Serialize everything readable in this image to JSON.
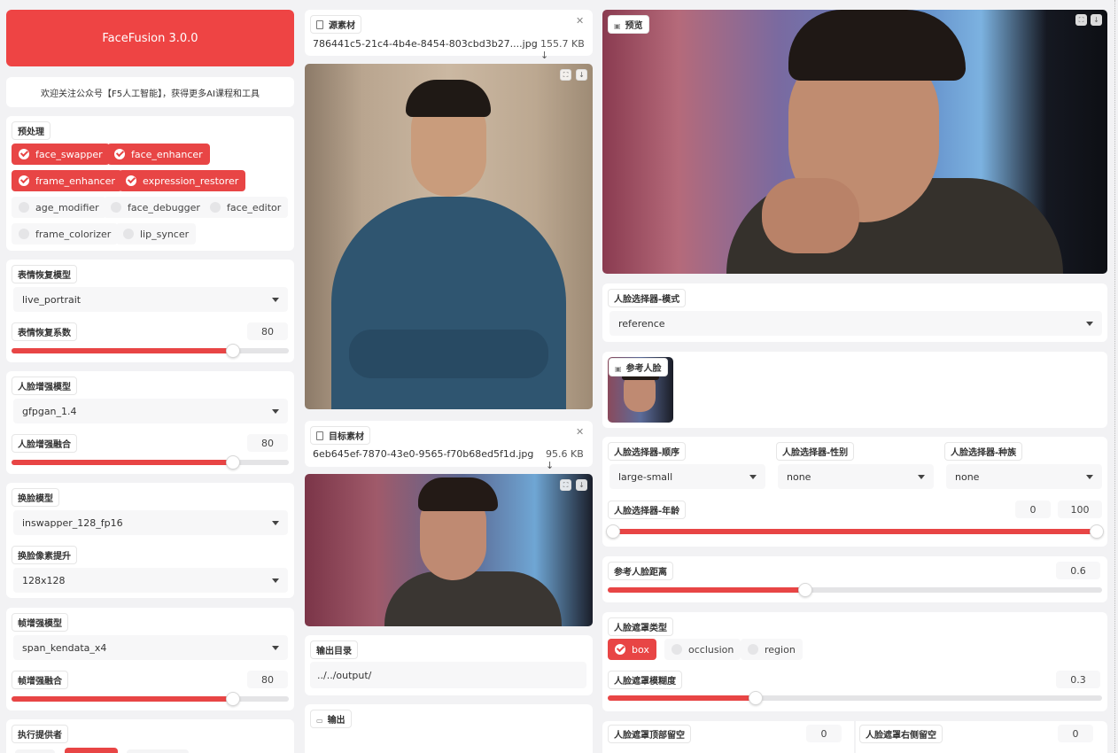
{
  "header": {
    "title": "FaceFusion 3.0.0",
    "subtitle": "欢迎关注公众号【F5人工智能】，获得更多AI课程和工具"
  },
  "processors": {
    "label": "预处理",
    "items": [
      {
        "label": "face_swapper",
        "checked": true
      },
      {
        "label": "face_enhancer",
        "checked": true
      },
      {
        "label": "frame_enhancer",
        "checked": true
      },
      {
        "label": "expression_restorer",
        "checked": true
      },
      {
        "label": "age_modifier",
        "checked": false
      },
      {
        "label": "face_debugger",
        "checked": false
      },
      {
        "label": "face_editor",
        "checked": false
      },
      {
        "label": "frame_colorizer",
        "checked": false
      },
      {
        "label": "lip_syncer",
        "checked": false
      }
    ]
  },
  "expression": {
    "model_label": "表情恢复模型",
    "model_value": "live_portrait",
    "factor_label": "表情恢复系数",
    "factor_value": "80",
    "factor_level": 0.8
  },
  "enhancer": {
    "model_label": "人脸增强模型",
    "model_value": "gfpgan_1.4",
    "blend_label": "人脸增强融合",
    "blend_value": "80",
    "blend_level": 0.8
  },
  "swapper": {
    "model_label": "换脸模型",
    "model_value": "inswapper_128_fp16",
    "pixel_label": "换脸像素提升",
    "pixel_value": "128x128"
  },
  "frame": {
    "model_label": "帧增强模型",
    "model_value": "span_kendata_x4",
    "blend_label": "帧增强融合",
    "blend_value": "80",
    "blend_level": 0.8
  },
  "execution": {
    "label": "执行提供者"
  },
  "source": {
    "label": "源素材",
    "filename": "786441c5-21c4-4b4e-8454-803cbd3b27....jpg",
    "size": "155.7 KB ↓"
  },
  "target": {
    "label": "目标素材",
    "filename": "6eb645ef-7870-43e0-9565-f70b68ed5f1d.jpg",
    "size": "95.6 KB ↓"
  },
  "output": {
    "dir_label": "输出目录",
    "dir_value": "../../output/",
    "out_label": "输出"
  },
  "preview": {
    "label": "预览"
  },
  "selector": {
    "mode_label": "人脸选择器-模式",
    "mode_value": "reference",
    "ref_label": "参考人脸",
    "order_label": "人脸选择器-顺序",
    "order_value": "large-small",
    "gender_label": "人脸选择器-性别",
    "gender_value": "none",
    "race_label": "人脸选择器-种族",
    "race_value": "none",
    "age_label": "人脸选择器-年龄",
    "age_min": "0",
    "age_max": "100",
    "distance_label": "参考人脸距离",
    "distance_value": "0.6",
    "distance_level": 0.4
  },
  "mask": {
    "type_label": "人脸遮罩类型",
    "types": [
      {
        "label": "box",
        "checked": true
      },
      {
        "label": "occlusion",
        "checked": false
      },
      {
        "label": "region",
        "checked": false
      }
    ],
    "blur_label": "人脸遮罩模糊度",
    "blur_value": "0.3",
    "blur_level": 0.3,
    "top_label": "人脸遮罩顶部留空",
    "top_value": "0",
    "right_label": "人脸遮罩右侧留空",
    "right_value": "0"
  },
  "colors": {
    "accent": "#e84545",
    "panel": "#ffffff",
    "background": "#f2f2f4"
  },
  "icons": [
    "file-icon",
    "close-icon",
    "fullscreen-icon",
    "download-icon",
    "image-icon",
    "video-icon",
    "chevron-down-icon",
    "checkmark-icon"
  ]
}
